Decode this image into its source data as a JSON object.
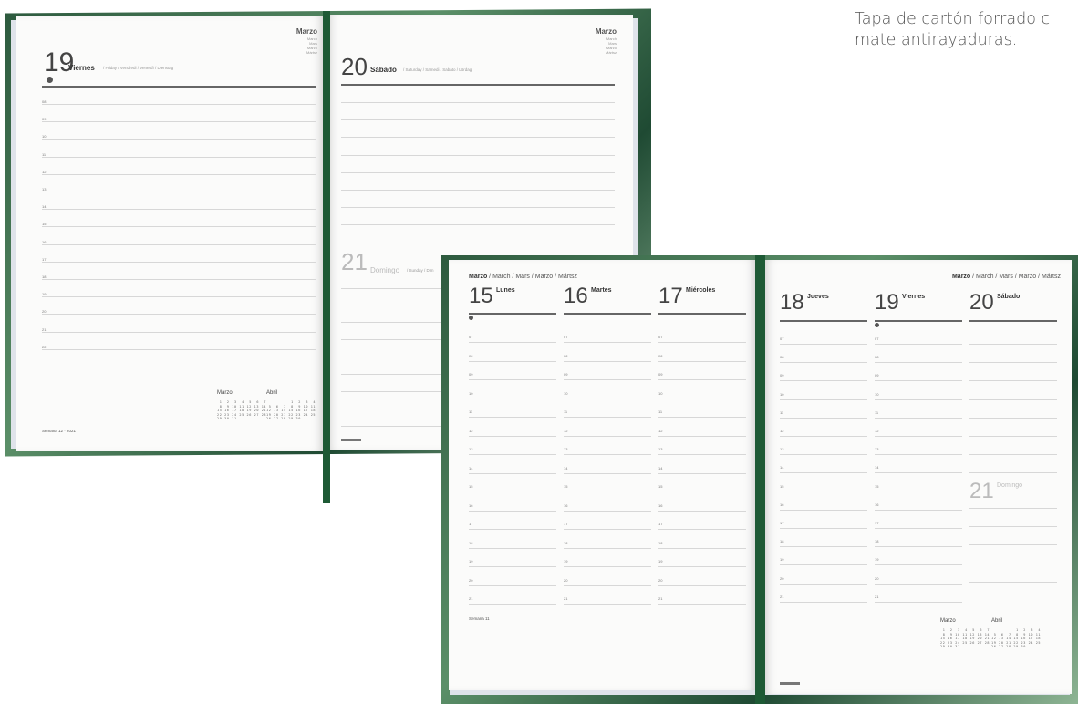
{
  "caption": {
    "line1": "Tapa de cartón forrado c",
    "line2": "mate antirayaduras."
  },
  "diary_day": {
    "left": {
      "day_number": "19",
      "day_name": "Viernes",
      "day_translations": "/ Friday / Vendredi / Venerdì / Dienstag",
      "month": "Marzo",
      "month_translations": [
        "March",
        "Mars",
        "Marzo",
        "Mártsz"
      ],
      "hours": [
        "08",
        "09",
        "10",
        "11",
        "12",
        "13",
        "14",
        "15",
        "16",
        "17",
        "18",
        "19",
        "20",
        "21",
        "22"
      ],
      "footer": "Semana 12 · 2021",
      "mini_calendars": [
        {
          "title": "Marzo",
          "grid": " 1  2  3  4  5  6  7\n 8  9 10 11 12 13 14\n15 16 17 18 19 20 21\n22 23 24 25 26 27 28\n29 30 31"
        },
        {
          "title": "Abril",
          "grid": "          1  2  3  4\n 5  6  7  8  9 10 11\n12 13 14 15 16 17 18\n19 20 21 22 23 24 25\n26 27 28 29 30"
        }
      ]
    },
    "right": {
      "day_number": "20",
      "day_name": "Sábado",
      "day_translations": "/ Saturday / Samedi / Sabato / Lördag",
      "month": "Marzo",
      "month_translations": [
        "March",
        "Mars",
        "Marzo",
        "Mártsz"
      ],
      "sunday_number": "21",
      "sunday_name": "Domingo",
      "sunday_translations": "/ Sunday / Dim"
    }
  },
  "diary_week": {
    "left": {
      "header_month": "Marzo",
      "header_translations": "/ March / Mars / Marzo / Mártsz",
      "days": [
        {
          "number": "15",
          "name": "Lunes"
        },
        {
          "number": "16",
          "name": "Martes"
        },
        {
          "number": "17",
          "name": "Miércoles"
        }
      ],
      "hours": [
        "07",
        "08",
        "09",
        "10",
        "11",
        "12",
        "13",
        "14",
        "15",
        "16",
        "17",
        "18",
        "19",
        "20",
        "21"
      ],
      "footer": "Semana 11"
    },
    "right": {
      "header_month": "Marzo",
      "header_translations": "/ March / Mars / Marzo / Mártsz",
      "days": [
        {
          "number": "18",
          "name": "Jueves"
        },
        {
          "number": "19",
          "name": "Viernes"
        },
        {
          "number": "20",
          "name": "Sábado"
        }
      ],
      "sunday_number": "21",
      "sunday_name": "Domingo",
      "hours": [
        "07",
        "08",
        "09",
        "10",
        "11",
        "12",
        "13",
        "14",
        "15",
        "16",
        "17",
        "18",
        "19",
        "20",
        "21"
      ],
      "mini_calendars": [
        {
          "title": "Marzo",
          "grid": " 1  2  3  4  5  6  7\n 8  9 10 11 12 13 14\n15 16 17 18 19 20 21\n22 23 24 25 26 27 28\n29 30 31"
        },
        {
          "title": "Abril",
          "grid": "          1  2  3  4\n 5  6  7  8  9 10 11\n12 13 14 15 16 17 18\n19 20 21 22 23 24 25\n26 27 28 29 30"
        }
      ]
    }
  },
  "colors": {
    "cover_green": "#2d5a3e",
    "ribbon": "#1e5a35",
    "page": "#fbfbfa"
  }
}
